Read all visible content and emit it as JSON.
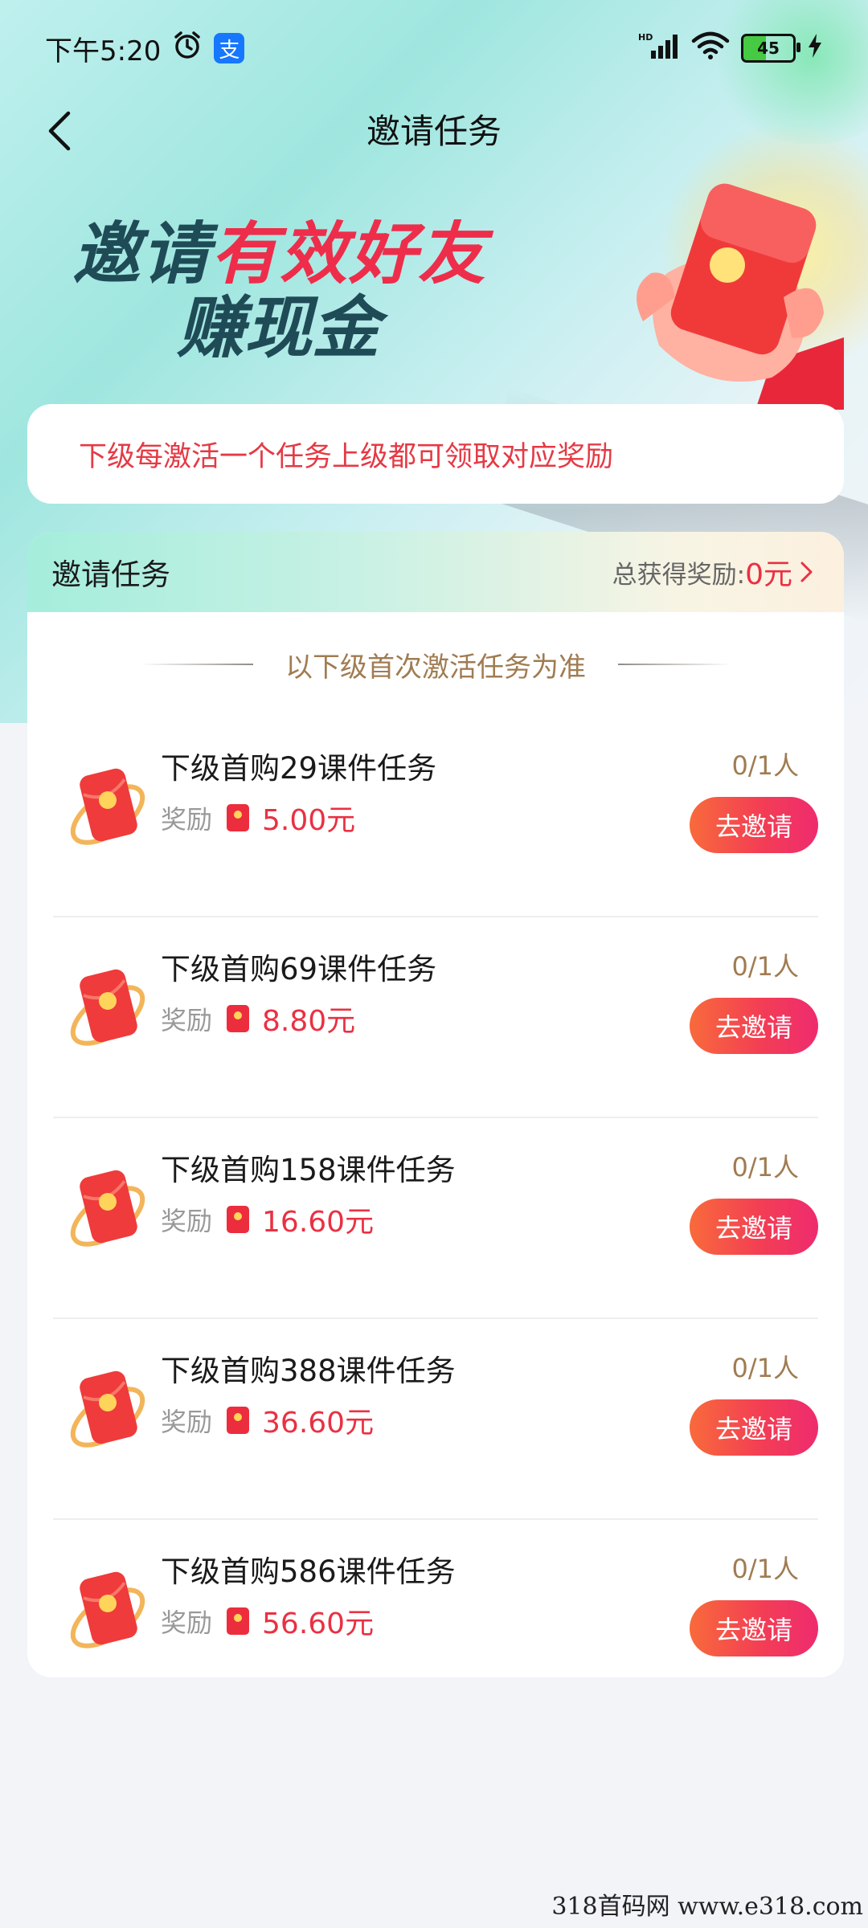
{
  "status_bar": {
    "time": "下午5:20",
    "alarm_icon": "alarm-clock-icon",
    "alipay_icon_glyph": "支",
    "network": "HD",
    "battery": "45"
  },
  "nav": {
    "title": "邀请任务"
  },
  "hero": {
    "line1_prefix": "邀请",
    "line1_highlight": "有效好友",
    "line2": "赚现金"
  },
  "notice": {
    "text": "下级每激活一个任务上级都可领取对应奖励"
  },
  "task_panel": {
    "title": "邀请任务",
    "total_label": "总获得奖励:",
    "total_amount": "0元",
    "subtitle": "以下级首次激活任务为准",
    "reward_label": "奖励",
    "button_label": "去邀请",
    "tasks": [
      {
        "title": "下级首购29课件任务",
        "reward": "5.00元",
        "progress": "0/1人"
      },
      {
        "title": "下级首购69课件任务",
        "reward": "8.80元",
        "progress": "0/1人"
      },
      {
        "title": "下级首购158课件任务",
        "reward": "16.60元",
        "progress": "0/1人"
      },
      {
        "title": "下级首购388课件任务",
        "reward": "36.60元",
        "progress": "0/1人"
      },
      {
        "title": "下级首购586课件任务",
        "reward": "56.60元",
        "progress": "0/1人"
      }
    ]
  },
  "watermark": "318首码网  www.e318.com",
  "colors": {
    "accent_red": "#e93143",
    "hero_dark": "#1f4b57",
    "gold_text": "#a07c52"
  }
}
